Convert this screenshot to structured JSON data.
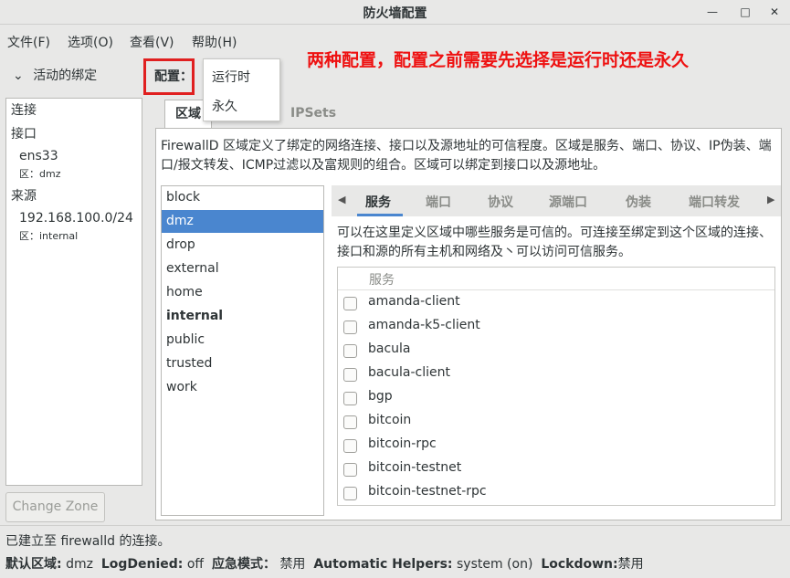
{
  "window": {
    "title": "防火墙配置",
    "minimize": "—",
    "maximize": "□",
    "close": "✕"
  },
  "menu": [
    "文件(F)",
    "选项(O)",
    "查看(V)",
    "帮助(H)"
  ],
  "annotation": "两种配置，配置之前需要先选择是运行时还是永久",
  "sidebar": {
    "header": "活动的绑定",
    "connection_label": "连接",
    "interface_label": "接口",
    "interface_name": "ens33",
    "interface_zone": "区：dmz",
    "source_label": "来源",
    "source_addr": "192.168.100.0/24",
    "source_zone": "区：internal",
    "change_zone_button": "Change Zone"
  },
  "config": {
    "label": "配置：",
    "options": [
      "运行时",
      "永久"
    ]
  },
  "top_tabs": [
    "区域",
    "IPSets"
  ],
  "zone_description": "FirewallD 区域定义了绑定的网络连接、接口以及源地址的可信程度。区域是服务、端口、协议、IP伪装、端口/报文转发、ICMP过滤以及富规则的组合。区域可以绑定到接口以及源地址。",
  "zones": [
    "block",
    "dmz",
    "drop",
    "external",
    "home",
    "internal",
    "public",
    "trusted",
    "work"
  ],
  "selected_zone": "dmz",
  "sub_tabs": [
    "服务",
    "端口",
    "协议",
    "源端口",
    "伪装",
    "端口转发"
  ],
  "services_description": "可以在这里定义区域中哪些服务是可信的。可连接至绑定到这个区域的连接、接口和源的所有主机和网络及丶可以访问可信服务。",
  "services_header": "服务",
  "services": [
    "amanda-client",
    "amanda-k5-client",
    "bacula",
    "bacula-client",
    "bgp",
    "bitcoin",
    "bitcoin-rpc",
    "bitcoin-testnet",
    "bitcoin-testnet-rpc"
  ],
  "status": {
    "connection": "已建立至 firewalld 的连接。",
    "default_zone_label": "默认区域:",
    "default_zone_value": "dmz",
    "log_denied_label": "LogDenied:",
    "log_denied_value": "off",
    "emergency_label": "应急模式：",
    "emergency_value": "禁用",
    "helpers_label": "Automatic Helpers:",
    "helpers_value": "system (on)",
    "lockdown_label": "Lockdown:",
    "lockdown_value": "禁用"
  }
}
